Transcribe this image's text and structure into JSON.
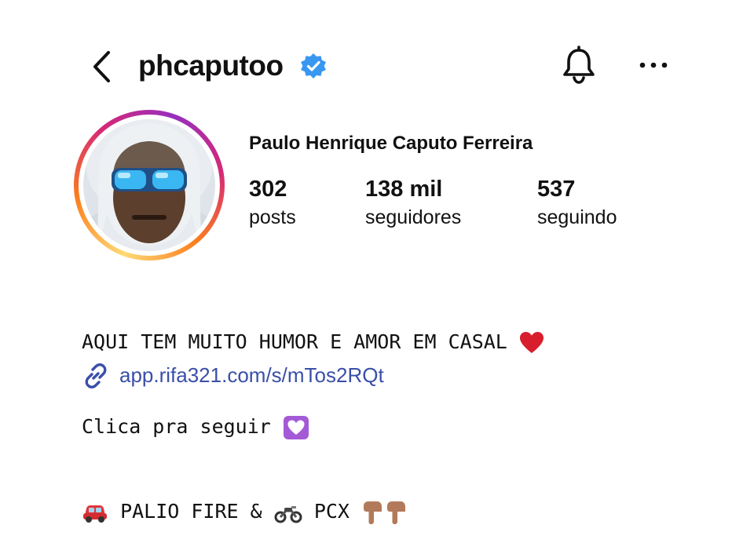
{
  "header": {
    "username": "phcaputoo",
    "verified": true,
    "icons": [
      "back-arrow-icon",
      "verified-badge-icon",
      "bell-icon",
      "more-options-icon"
    ]
  },
  "profile": {
    "full_name": "Paulo Henrique Caputo Ferreira",
    "stats": [
      {
        "value": "302",
        "label": "posts"
      },
      {
        "value": "138 mil",
        "label": "seguidores"
      },
      {
        "value": "537",
        "label": "seguindo"
      }
    ]
  },
  "bio": {
    "line1": "AQUI TEM MUITO HUMOR E AMOR EM CASAL",
    "line2": "Clica pra seguir",
    "line3_a": "PALIO FIRE &",
    "line3_b": "PCX",
    "emojis": [
      "red-heart-emoji",
      "heart-box-emoji",
      "car-emoji",
      "motorcycle-emoji",
      "pointing-down-emoji"
    ]
  },
  "link": {
    "url": "app.rifa321.com/s/mTos2RQt"
  },
  "colors": {
    "verified_blue": "#3897f0",
    "link_blue": "#3a4fa8",
    "ring_gradient": [
      "#feda75",
      "#fa7e1e",
      "#d62976",
      "#962fbf"
    ]
  }
}
